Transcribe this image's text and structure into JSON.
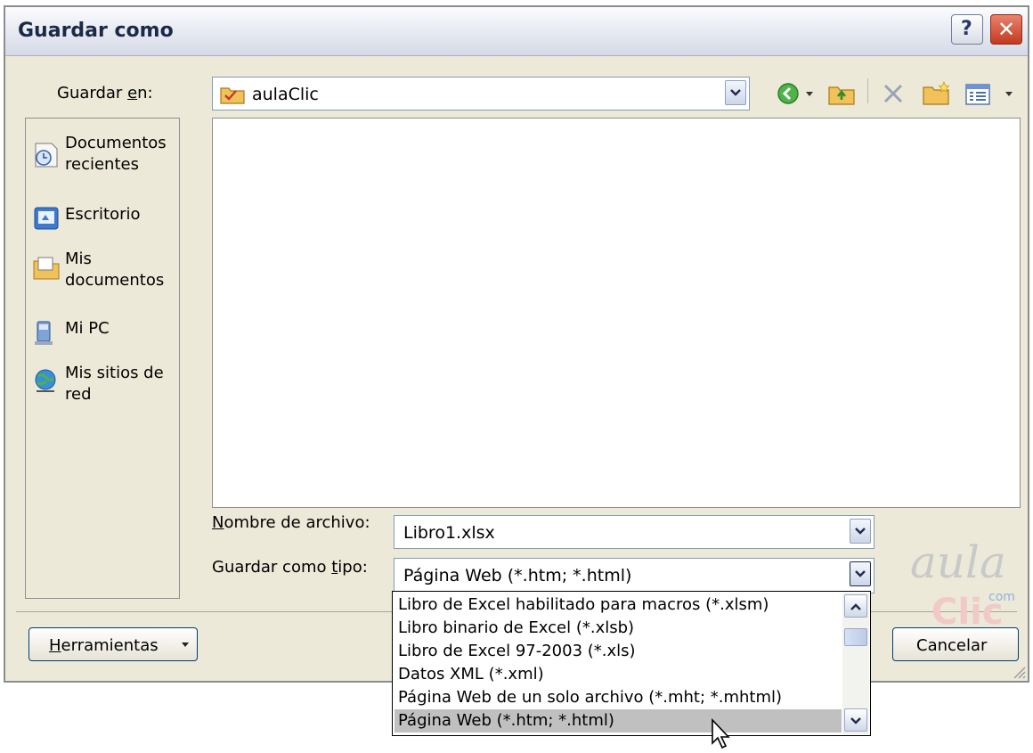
{
  "window": {
    "title": "Guardar como",
    "help_glyph": "?",
    "close_glyph": "✕"
  },
  "save_in": {
    "label_pre": "Guardar ",
    "label_mnemonic": "e",
    "label_post": "n:",
    "value": "aulaClic",
    "icon": "folder-icon"
  },
  "toolbar": {
    "icons": [
      "back-icon",
      "up-folder-icon",
      "delete-icon",
      "new-folder-icon",
      "views-icon"
    ]
  },
  "places": [
    {
      "label": "Documentos recientes",
      "icon": "recent-documents-icon"
    },
    {
      "label": "Escritorio",
      "icon": "desktop-icon"
    },
    {
      "label": "Mis documentos",
      "icon": "my-documents-icon"
    },
    {
      "label": "Mi PC",
      "icon": "my-computer-icon"
    },
    {
      "label": "Mis sitios de red",
      "icon": "network-places-icon"
    }
  ],
  "filename": {
    "label_mnemonic": "N",
    "label_rest": "ombre de archivo:",
    "value": "Libro1.xlsx"
  },
  "filetype": {
    "label_pre": "Guardar como ",
    "label_mnemonic": "t",
    "label_post": "ipo:",
    "value": "Página Web (*.htm; *.html)",
    "options": [
      "Libro de Excel habilitado para macros (*.xlsm)",
      "Libro binario de Excel (*.xlsb)",
      "Libro de Excel 97-2003 (*.xls)",
      "Datos XML (*.xml)",
      "Página Web de un solo archivo (*.mht; *.mhtml)",
      "Página Web (*.htm; *.html)"
    ],
    "selected_index": 5
  },
  "buttons": {
    "tools_mnemonic": "H",
    "tools_rest": "erramientas",
    "cancel": "Cancelar"
  },
  "logo": {
    "line1": "aula",
    "line2": "com",
    "line3": "Clic"
  },
  "colors": {
    "dialog_bg": "#ece9d8",
    "close_button": "#c23b1f",
    "selection": "#c0c0c0"
  }
}
